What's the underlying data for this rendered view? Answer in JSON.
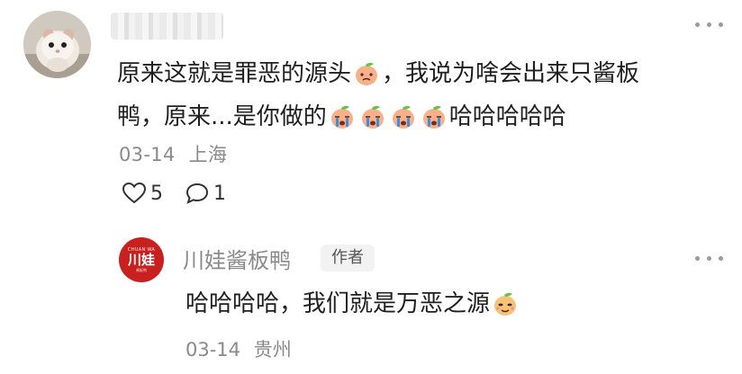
{
  "comment": {
    "avatar_icon": "hamster-photo-avatar",
    "username": "",
    "line1_a": "原来这就是罪恶的源头",
    "line1_b": "，我说为啥会出来只酱板",
    "line2_a": "鸭，原来...是你做的",
    "line2_b": "哈哈哈哈哈",
    "date": "03-14",
    "location": "上海",
    "like_count": "5",
    "reply_count": "1"
  },
  "reply": {
    "avatar_top": "CHUAN WA",
    "avatar_brand": "川娃",
    "avatar_bottom": "酱板鸭",
    "name": "川娃酱板鸭",
    "badge": "作者",
    "text": "哈哈哈哈，我们就是万恶之源",
    "date": "03-14",
    "location": "贵州"
  },
  "colors": {
    "accent_red": "#c8201f",
    "meta_gray": "#8a8a8a",
    "emoji_peach": "#f6b08a",
    "emoji_leaf": "#6bbf4a"
  }
}
